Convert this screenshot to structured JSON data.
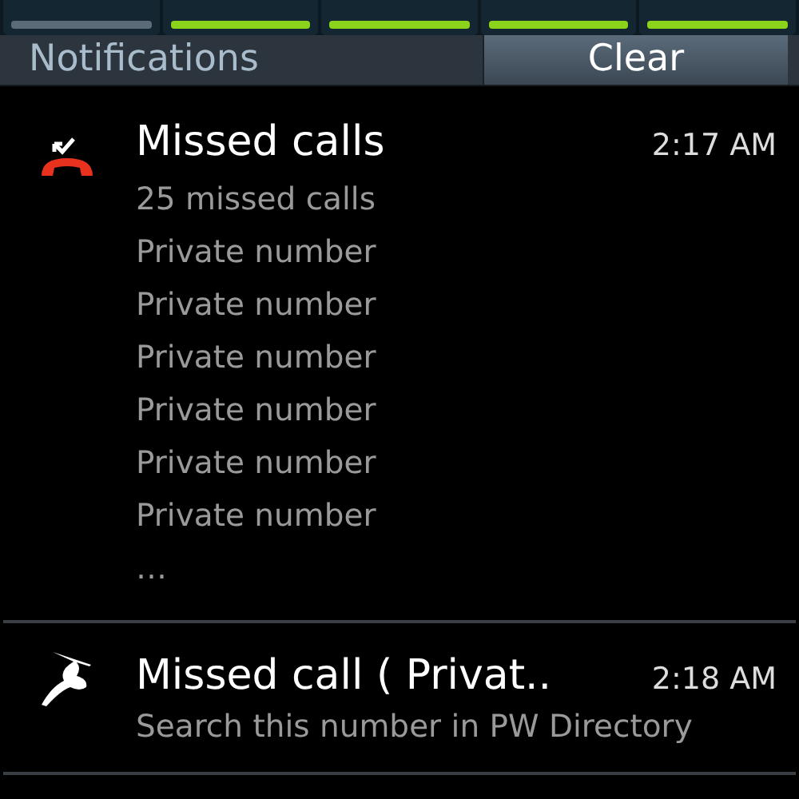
{
  "quick_toggles": [
    {
      "on": false
    },
    {
      "on": true
    },
    {
      "on": true
    },
    {
      "on": true
    },
    {
      "on": true
    }
  ],
  "header": {
    "title": "Notifications",
    "clear_button": "Clear"
  },
  "notifications": [
    {
      "kind": "missed",
      "title": "Missed calls",
      "time": "2:17 AM",
      "lines": [
        "25 missed calls",
        "Private number",
        "Private number",
        "Private number",
        "Private number",
        "Private number",
        "Private number",
        "…"
      ]
    },
    {
      "kind": "app",
      "title": "Missed call ( Privat..",
      "time": "2:18 AM",
      "lines": [
        "Search this number in PW Directory"
      ]
    }
  ]
}
